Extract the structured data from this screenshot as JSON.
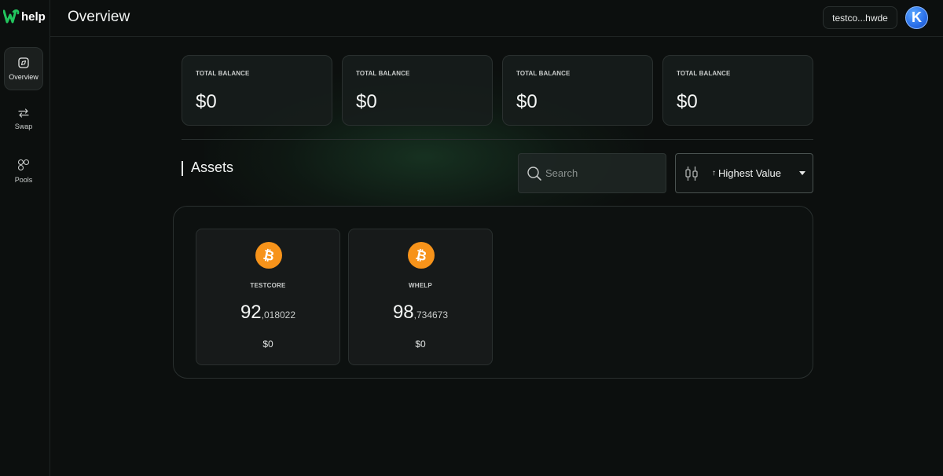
{
  "app": {
    "logo_text": "help",
    "accent_color": "#22c55e"
  },
  "sidebar": {
    "items": [
      {
        "label": "Overview",
        "icon": "compass-icon",
        "active": true
      },
      {
        "label": "Swap",
        "icon": "swap-arrows-icon",
        "active": false
      },
      {
        "label": "Pools",
        "icon": "pools-circles-icon",
        "active": false
      }
    ]
  },
  "header": {
    "title": "Overview",
    "wallet_label": "testco...hwde",
    "avatar_initial": "K"
  },
  "balances": [
    {
      "label": "TOTAL BALANCE",
      "value": "$0"
    },
    {
      "label": "TOTAL BALANCE",
      "value": "$0"
    },
    {
      "label": "TOTAL BALANCE",
      "value": "$0"
    },
    {
      "label": "TOTAL BALANCE",
      "value": "$0"
    }
  ],
  "assets_section": {
    "title": "Assets",
    "search_placeholder": "Search",
    "sort_arrow": "↑",
    "sort_label": "Highest Value"
  },
  "assets": [
    {
      "name": "TESTCORE",
      "amount_int": "92",
      "amount_dec": ",018022",
      "usd": "$0",
      "icon": "bitcoin-icon",
      "icon_color": "#f7931a"
    },
    {
      "name": "WHELP",
      "amount_int": "98",
      "amount_dec": ",734673",
      "usd": "$0",
      "icon": "bitcoin-icon",
      "icon_color": "#f7931a"
    }
  ]
}
